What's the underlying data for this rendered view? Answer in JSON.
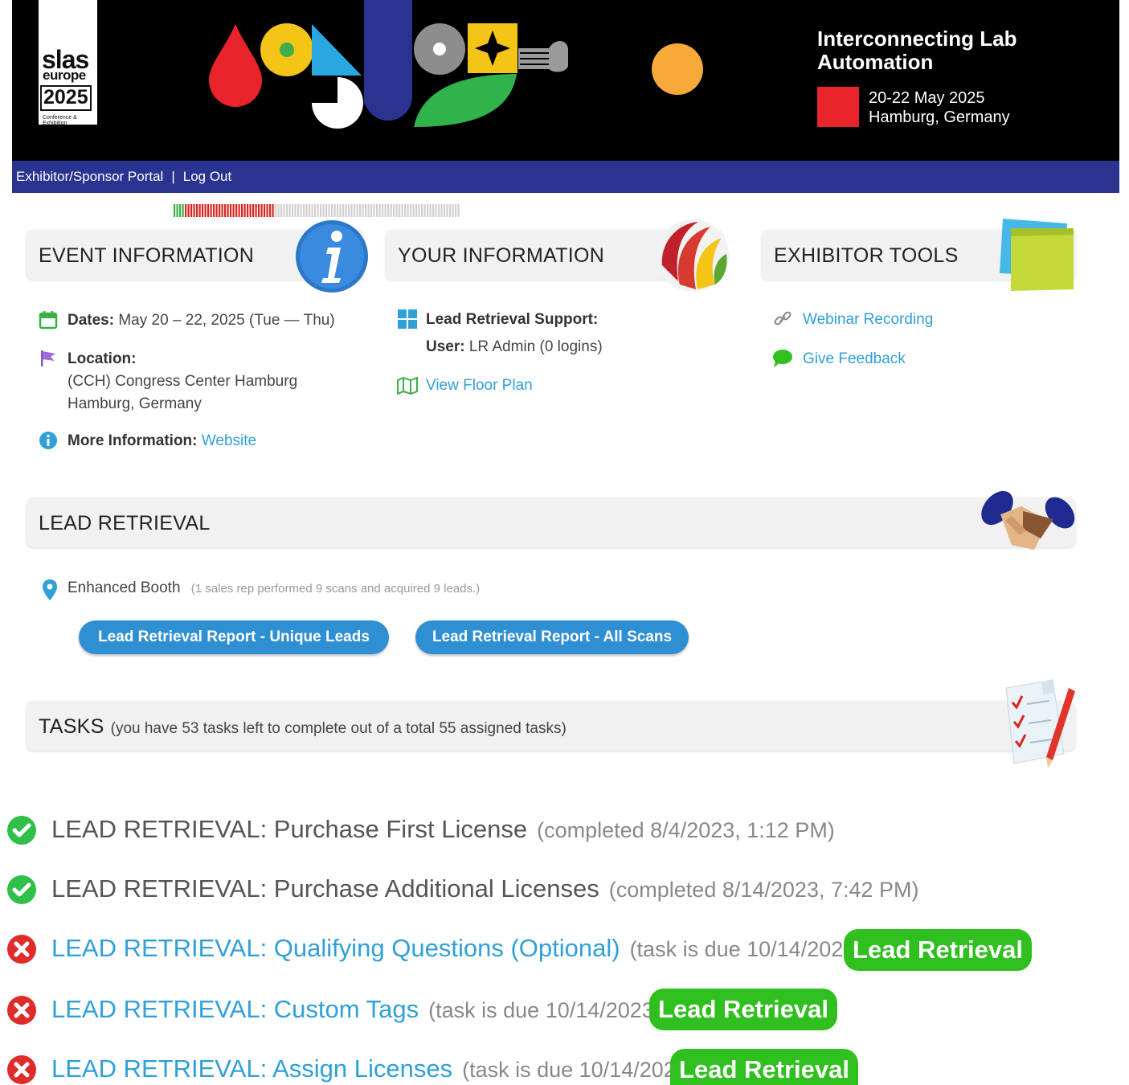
{
  "banner": {
    "logo": {
      "slas": "slas",
      "europe": "europe",
      "year": "2025",
      "sub": "Conference & Exhibition"
    },
    "title": "Interconnecting Lab Automation",
    "dates": "20-22 May 2025",
    "location": "Hamburg, Germany"
  },
  "nav": {
    "portal": "Exhibitor/Sponsor Portal",
    "separator": "|",
    "logout": "Log Out"
  },
  "event_info": {
    "title": "EVENT INFORMATION",
    "dates_label": "Dates:",
    "dates_value": "May 20 – 22, 2025 (Tue — Thu)",
    "location_label": "Location:",
    "location_line1": "(CCH) Congress Center Hamburg",
    "location_line2": "Hamburg, Germany",
    "more_label": "More Information:",
    "more_link": "Website"
  },
  "your_info": {
    "title": "YOUR INFORMATION",
    "support_label": "Lead Retrieval Support:",
    "user_label": "User:",
    "user_value": "LR Admin (0 logins)",
    "floor_plan": "View Floor Plan"
  },
  "exhibitor_tools": {
    "title": "EXHIBITOR TOOLS",
    "webinar": "Webinar Recording",
    "feedback": "Give Feedback"
  },
  "lead_retrieval": {
    "title": "LEAD RETRIEVAL",
    "booth": "Enhanced Booth",
    "booth_note": "(1 sales rep performed 9 scans and acquired 9 leads.)",
    "btn_unique": "Lead Retrieval Report - Unique Leads",
    "btn_all": "Lead Retrieval Report - All Scans"
  },
  "tasks": {
    "title": "TASKS",
    "note": "(you have 53 tasks left to complete out of a total 55 assigned tasks)",
    "items": [
      {
        "label": "LEAD RETRIEVAL: Purchase First License",
        "meta": "(completed 8/4/2023, 1:12 PM)",
        "done": true
      },
      {
        "label": "LEAD RETRIEVAL: Purchase Additional Licenses",
        "meta": "(completed 8/14/2023, 7:42 PM)",
        "done": true
      },
      {
        "label": "LEAD RETRIEVAL: Qualifying Questions (Optional)",
        "meta": "(task is due 10/14/2023)",
        "done": false,
        "button": "Lead Retrieval"
      },
      {
        "label": "LEAD RETRIEVAL: Custom Tags",
        "meta": "(task is due 10/14/2023)",
        "done": false,
        "button": "Lead Retrieval"
      },
      {
        "label": "LEAD RETRIEVAL: Assign Licenses",
        "meta": "(task is due 10/14/2023)",
        "done": false,
        "button": "Lead Retrieval"
      }
    ]
  },
  "colors": {
    "nav": "#2b3391",
    "link": "#2fa0d8",
    "button_blue": "#2f8fd3",
    "button_green": "#2fbf1f",
    "done": "#2fbf4a",
    "todo": "#e02b2b"
  }
}
